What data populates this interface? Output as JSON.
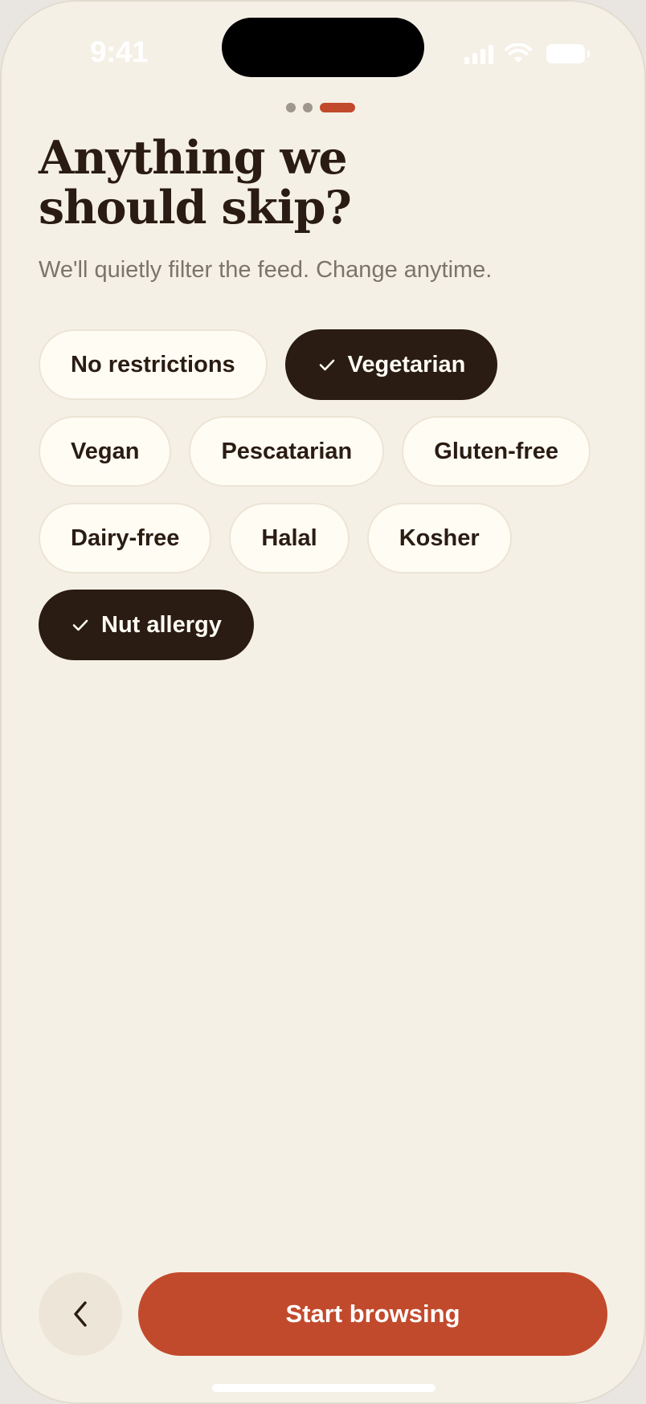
{
  "status_bar": {
    "time": "9:41"
  },
  "progress": {
    "steps": 3,
    "current": 3
  },
  "header": {
    "title_line1": "Anything we",
    "title_line2": "should skip?",
    "subtitle": "We'll quietly filter the feed. Change anytime."
  },
  "options": [
    {
      "label": "No restrictions",
      "selected": false
    },
    {
      "label": "Vegetarian",
      "selected": true
    },
    {
      "label": "Vegan",
      "selected": false
    },
    {
      "label": "Pescatarian",
      "selected": false
    },
    {
      "label": "Gluten-free",
      "selected": false
    },
    {
      "label": "Dairy-free",
      "selected": false
    },
    {
      "label": "Halal",
      "selected": false
    },
    {
      "label": "Kosher",
      "selected": false
    },
    {
      "label": "Nut allergy",
      "selected": true
    }
  ],
  "footer": {
    "cta_label": "Start browsing"
  },
  "icons": {
    "back": "chevron-left-icon",
    "check": "check-icon",
    "signal": "cellular-signal-icon",
    "wifi": "wifi-icon",
    "battery": "battery-icon"
  },
  "colors": {
    "background": "#f5f0e6",
    "accent": "#c24a2c",
    "ink": "#2a1c12",
    "chip_bg": "#fffcf4",
    "muted": "#7c746b"
  }
}
